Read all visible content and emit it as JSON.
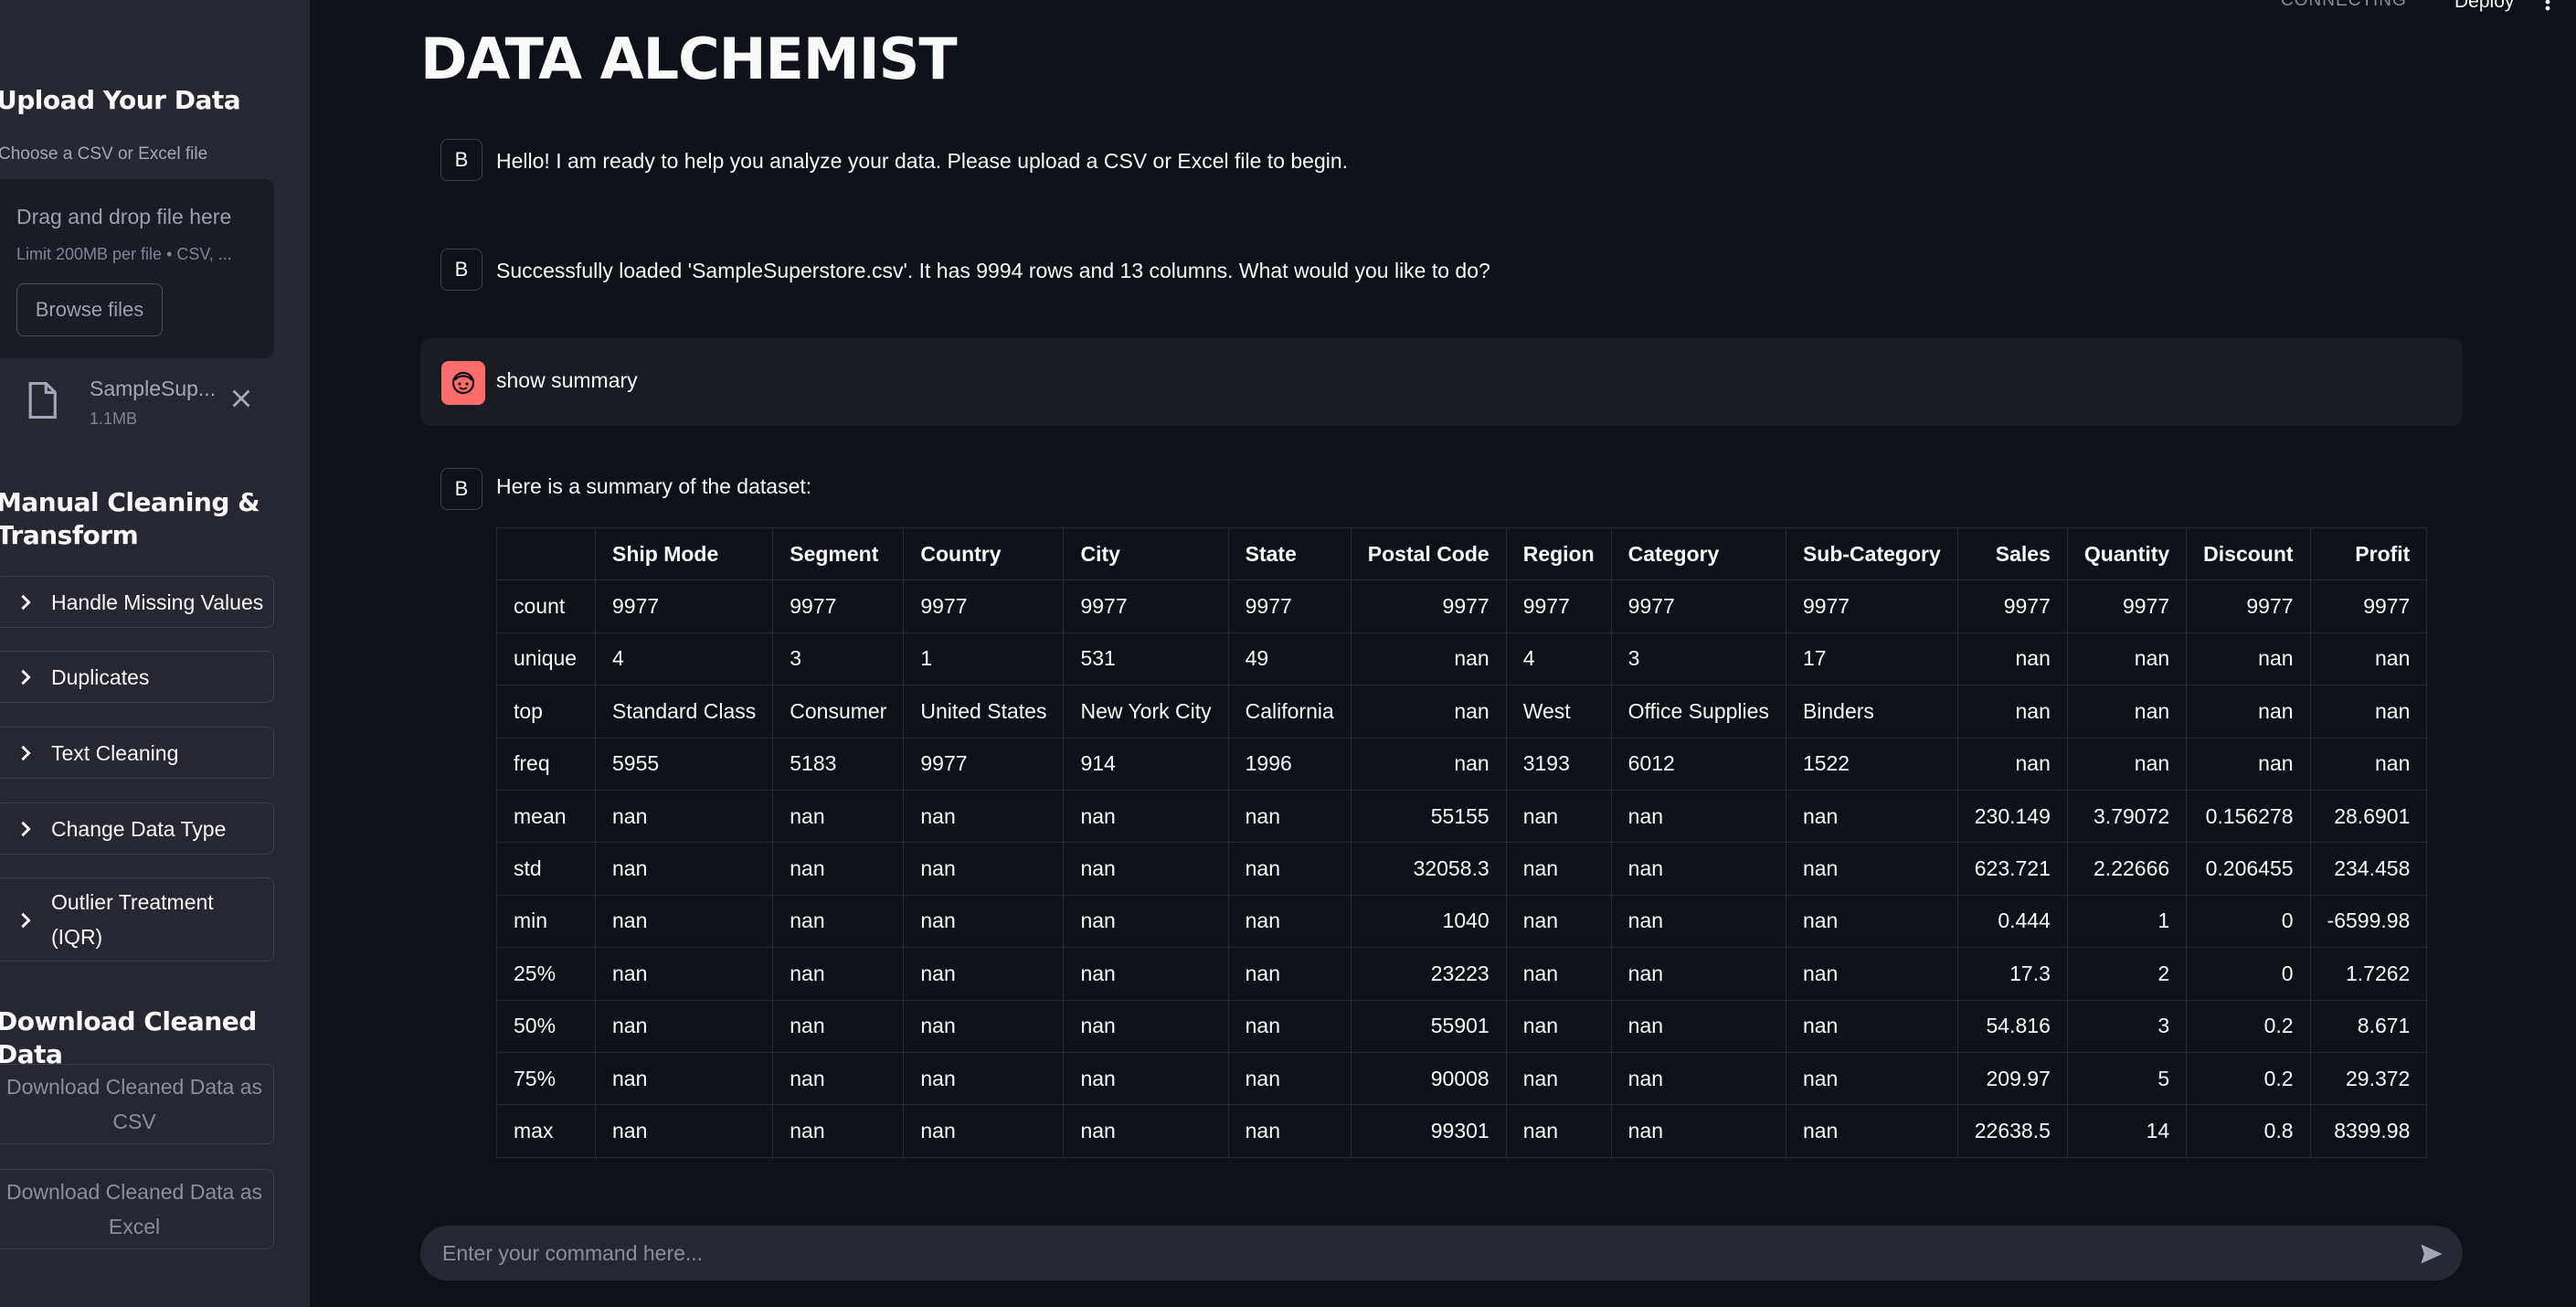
{
  "sidebar": {
    "upload_heading": "Upload Your Data",
    "uploader_label": "Choose a CSV or Excel file",
    "dropzone_title": "Drag and drop file here",
    "dropzone_limit": "Limit 200MB per file • CSV, ...",
    "browse_label": "Browse files",
    "file": {
      "name": "SampleSup...",
      "size": "1.1MB"
    },
    "manual_heading_1": "Manual Cleaning &",
    "manual_heading_2": "Transform",
    "expanders": [
      {
        "label": "Handle Missing Values"
      },
      {
        "label": "Duplicates"
      },
      {
        "label": "Text Cleaning"
      },
      {
        "label": "Change Data Type"
      },
      {
        "label_1": "Outlier Treatment",
        "label_2": "(IQR)"
      }
    ],
    "download_heading": "Download Cleaned Data",
    "download_csv_1": "Download Cleaned Data as",
    "download_csv_2": "CSV",
    "download_excel_1": "Download Cleaned Data as",
    "download_excel_2": "Excel"
  },
  "header": {
    "status": "CONNECTING",
    "deploy": "Deploy"
  },
  "app": {
    "title": "DATA ALCHEMIST"
  },
  "messages": [
    {
      "avatar": "B",
      "text": "Hello! I am ready to help you analyze your data. Please upload a CSV or Excel file to begin."
    },
    {
      "avatar": "B",
      "text": "Successfully loaded 'SampleSuperstore.csv'. It has 9994 rows and 13 columns. What would you like to do?"
    },
    {
      "avatar": "user",
      "text": "show summary"
    },
    {
      "avatar": "B",
      "text": "Here is a summary of the dataset:"
    }
  ],
  "table": {
    "columns": [
      "",
      "Ship Mode",
      "Segment",
      "Country",
      "City",
      "State",
      "Postal Code",
      "Region",
      "Category",
      "Sub-Category",
      "Sales",
      "Quantity",
      "Discount",
      "Profit"
    ],
    "rows": [
      [
        "count",
        "9977",
        "9977",
        "9977",
        "9977",
        "9977",
        "9977",
        "9977",
        "9977",
        "9977",
        "9977",
        "9977",
        "9977",
        "9977"
      ],
      [
        "unique",
        "4",
        "3",
        "1",
        "531",
        "49",
        "nan",
        "4",
        "3",
        "17",
        "nan",
        "nan",
        "nan",
        "nan"
      ],
      [
        "top",
        "Standard Class",
        "Consumer",
        "United States",
        "New York City",
        "California",
        "nan",
        "West",
        "Office Supplies",
        "Binders",
        "nan",
        "nan",
        "nan",
        "nan"
      ],
      [
        "freq",
        "5955",
        "5183",
        "9977",
        "914",
        "1996",
        "nan",
        "3193",
        "6012",
        "1522",
        "nan",
        "nan",
        "nan",
        "nan"
      ],
      [
        "mean",
        "nan",
        "nan",
        "nan",
        "nan",
        "nan",
        "55155",
        "nan",
        "nan",
        "nan",
        "230.149",
        "3.79072",
        "0.156278",
        "28.6901"
      ],
      [
        "std",
        "nan",
        "nan",
        "nan",
        "nan",
        "nan",
        "32058.3",
        "nan",
        "nan",
        "nan",
        "623.721",
        "2.22666",
        "0.206455",
        "234.458"
      ],
      [
        "min",
        "nan",
        "nan",
        "nan",
        "nan",
        "nan",
        "1040",
        "nan",
        "nan",
        "nan",
        "0.444",
        "1",
        "0",
        "-6599.98"
      ],
      [
        "25%",
        "nan",
        "nan",
        "nan",
        "nan",
        "nan",
        "23223",
        "nan",
        "nan",
        "nan",
        "17.3",
        "2",
        "0",
        "1.7262"
      ],
      [
        "50%",
        "nan",
        "nan",
        "nan",
        "nan",
        "nan",
        "55901",
        "nan",
        "nan",
        "nan",
        "54.816",
        "3",
        "0.2",
        "8.671"
      ],
      [
        "75%",
        "nan",
        "nan",
        "nan",
        "nan",
        "nan",
        "90008",
        "nan",
        "nan",
        "nan",
        "209.97",
        "5",
        "0.2",
        "29.372"
      ],
      [
        "max",
        "nan",
        "nan",
        "nan",
        "nan",
        "nan",
        "99301",
        "nan",
        "nan",
        "nan",
        "22638.5",
        "14",
        "0.8",
        "8399.98"
      ]
    ]
  },
  "chat_input": {
    "placeholder": "Enter your command here..."
  },
  "colors": {
    "background": "#0e1117",
    "sidebar": "#262730",
    "user_avatar": "#ff6c6c"
  }
}
